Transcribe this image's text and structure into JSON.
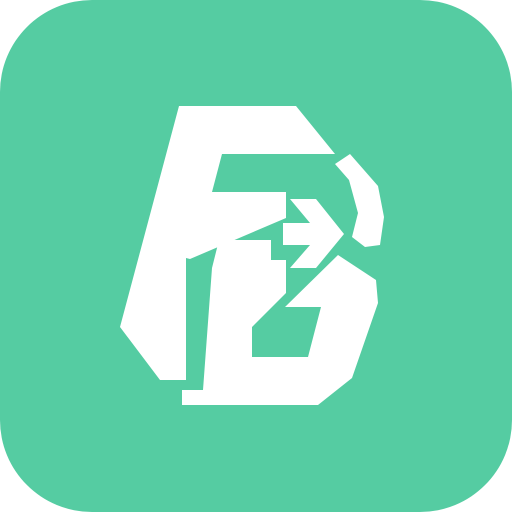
{
  "icon": {
    "name": "app-logo-icon",
    "letters": "FB",
    "background_color": "#55CCA2",
    "foreground_color": "#FFFFFF"
  }
}
